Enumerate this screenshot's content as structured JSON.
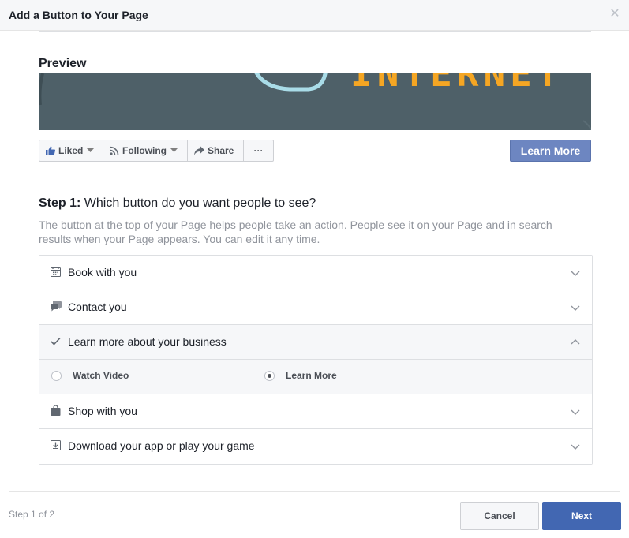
{
  "dialog": {
    "title": "Add a Button to Your Page",
    "close_icon": "close-icon"
  },
  "preview": {
    "label": "Preview",
    "cover_text": "INTERNET",
    "colors": {
      "cover_bg": "#4e6068",
      "cover_text": "#f5a623",
      "cover_ring": "#a9dce8"
    }
  },
  "action_bar": {
    "liked": {
      "label": "Liked",
      "icon": "thumbs-up-icon"
    },
    "following": {
      "label": "Following",
      "icon": "rss-icon"
    },
    "share": {
      "label": "Share",
      "icon": "share-arrow-icon"
    },
    "more": {
      "label": "···",
      "icon": "more-icon"
    }
  },
  "cta_preview": {
    "label": "Learn More",
    "color": "#6d86c1"
  },
  "step": {
    "title_strong": "Step 1:",
    "title_rest": " Which button do you want people to see?",
    "description": "The button at the top of your Page helps people take an action. People see it on your Page and in search results when your Page appears. You can edit it any time."
  },
  "options": [
    {
      "label": "Book with you",
      "icon": "calendar-icon",
      "expanded": false
    },
    {
      "label": "Contact you",
      "icon": "chat-icon",
      "expanded": false
    },
    {
      "label": "Learn more about your business",
      "icon": "check-icon",
      "expanded": true
    },
    {
      "label": "Shop with you",
      "icon": "shopping-bag-icon",
      "expanded": false
    },
    {
      "label": "Download your app or play your game",
      "icon": "download-icon",
      "expanded": false
    }
  ],
  "learn_more_choices": [
    {
      "label": "Watch Video",
      "selected": false
    },
    {
      "label": "Learn More",
      "selected": true
    }
  ],
  "footer": {
    "step_indicator": "Step 1 of 2",
    "cancel_label": "Cancel",
    "next_label": "Next",
    "next_color": "#4267b2"
  }
}
